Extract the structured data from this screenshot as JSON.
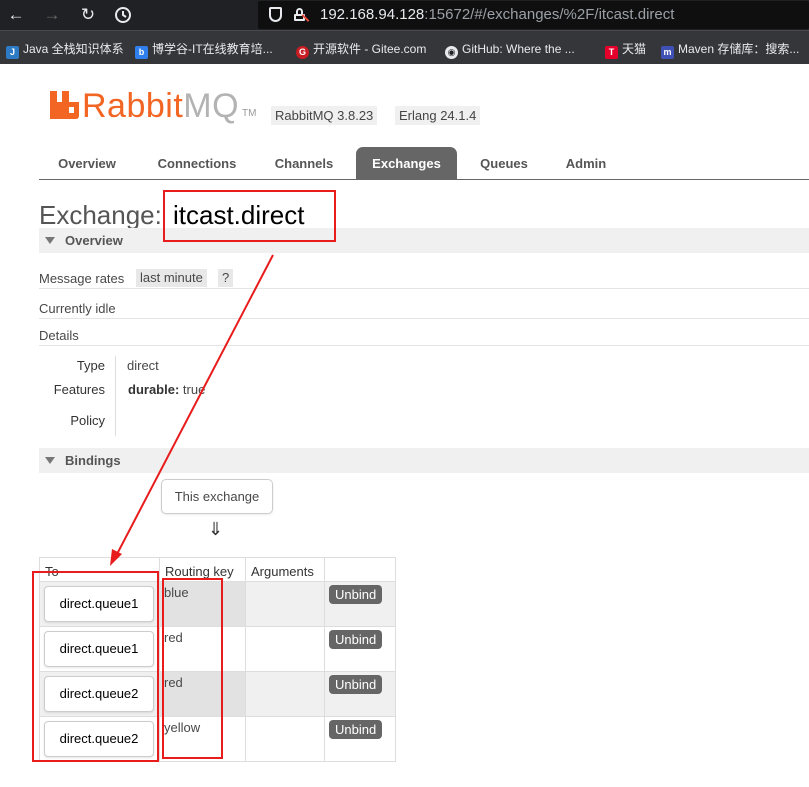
{
  "browser": {
    "url_host": "192.168.94.128",
    "url_rest": ":15672/#/exchanges/%2F/itcast.direct",
    "bookmarks": [
      {
        "label": "Java 全栈知识体系",
        "icon": "java-icon",
        "color": "#2d7bc4"
      },
      {
        "label": "博学谷-IT在线教育培...",
        "icon": "boxuegu-icon",
        "color": "#2f80ed"
      },
      {
        "label": "开源软件 - Gitee.com",
        "icon": "gitee-icon",
        "color": "#c71d23"
      },
      {
        "label": "GitHub: Where the ...",
        "icon": "github-icon",
        "color": "#e8eaed"
      },
      {
        "label": "天猫",
        "icon": "tmall-icon",
        "color": "#e4002b"
      },
      {
        "label": "Maven 存储库：搜索...",
        "icon": "maven-icon",
        "color": "#3f51b5"
      }
    ]
  },
  "header": {
    "logo_rabbit": "Rabbit",
    "logo_mq": "MQ",
    "logo_tm": "TM",
    "version": "RabbitMQ 3.8.23",
    "erlang": "Erlang 24.1.4"
  },
  "tabs": [
    "Overview",
    "Connections",
    "Channels",
    "Exchanges",
    "Queues",
    "Admin"
  ],
  "active_tab": "Exchanges",
  "page": {
    "title_prefix": "Exchange:",
    "exchange_name": "itcast.direct"
  },
  "overview": {
    "heading": "Overview",
    "message_rates_label": "Message rates",
    "message_rates_period": "last minute",
    "help": "?",
    "status": "Currently idle",
    "details_label": "Details",
    "type_key": "Type",
    "type_value": "direct",
    "features_key": "Features",
    "features_durable_key": "durable:",
    "features_durable_value": "true",
    "policy_key": "Policy",
    "policy_value": ""
  },
  "bindings": {
    "heading": "Bindings",
    "source_label": "This exchange",
    "arrow": "⇓",
    "columns": [
      "To",
      "Routing key",
      "Arguments",
      ""
    ],
    "rows": [
      {
        "to": "direct.queue1",
        "routing_key": "blue",
        "arguments": "",
        "action": "Unbind"
      },
      {
        "to": "direct.queue1",
        "routing_key": "red",
        "arguments": "",
        "action": "Unbind"
      },
      {
        "to": "direct.queue2",
        "routing_key": "red",
        "arguments": "",
        "action": "Unbind"
      },
      {
        "to": "direct.queue2",
        "routing_key": "yellow",
        "arguments": "",
        "action": "Unbind"
      }
    ]
  },
  "annotation_color": "#e81c1c"
}
